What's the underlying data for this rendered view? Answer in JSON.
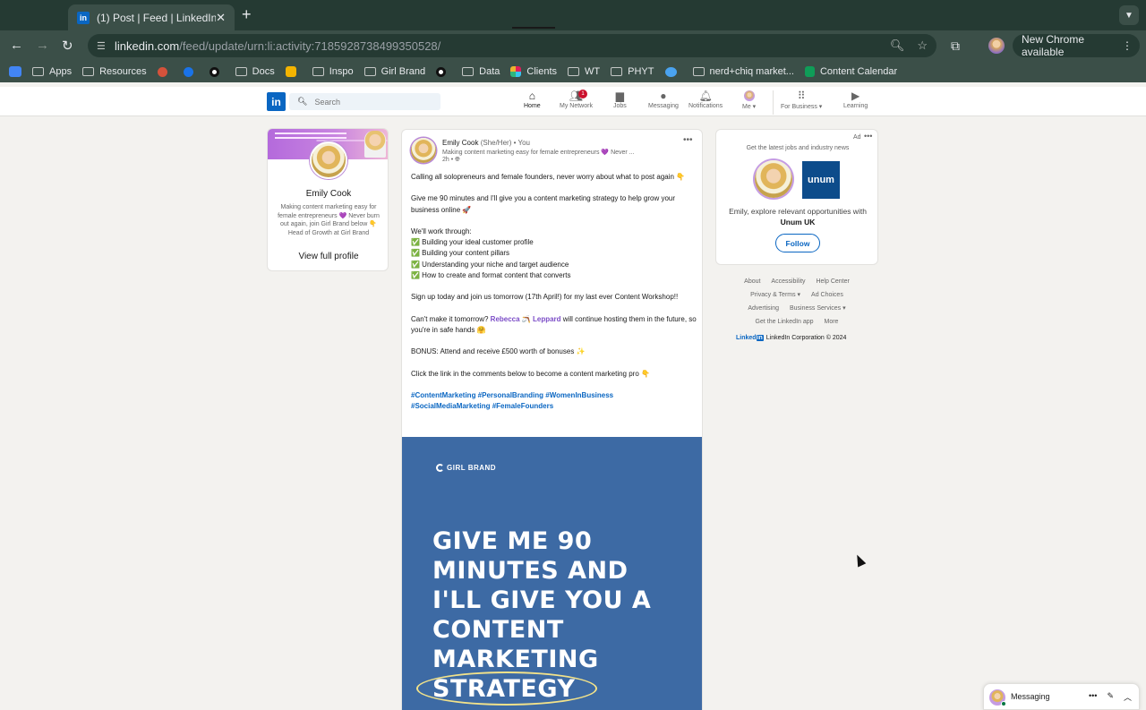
{
  "browser": {
    "tab_title": "(1) Post | Feed | LinkedIn",
    "url_host": "linkedin.com",
    "url_path": "/feed/update/urn:li:activity:7185928738499350528/",
    "new_chrome_label": "New Chrome available",
    "bookmarks": [
      "Apps",
      "Resources",
      "Docs",
      "Inspo",
      "Girl Brand",
      "Data",
      "Clients",
      "WT",
      "PHYT",
      "nerd+chiq market...",
      "Content Calendar"
    ]
  },
  "linkedin": {
    "search_placeholder": "Search",
    "nav": [
      {
        "label": "Home",
        "icon": "home-icon"
      },
      {
        "label": "My Network",
        "icon": "people-icon",
        "badge": "1"
      },
      {
        "label": "Jobs",
        "icon": "briefcase-icon"
      },
      {
        "label": "Messaging",
        "icon": "chat-icon"
      },
      {
        "label": "Notifications",
        "icon": "bell-icon"
      },
      {
        "label": "Me",
        "icon": "avatar-icon"
      },
      {
        "label": "For Business",
        "icon": "grid-icon"
      },
      {
        "label": "Learning",
        "icon": "play-icon"
      }
    ]
  },
  "profile_card": {
    "name": "Emily Cook",
    "headline": "Making content marketing easy for female entrepreneurs 💜 Never burn out again, join Girl Brand below 👇 Head of Growth at Girl Brand",
    "view_profile": "View full profile"
  },
  "post": {
    "author": "Emily Cook",
    "pronouns": "(She/Her)",
    "you_label": "• You",
    "headline": "Making content marketing easy for female entrepreneurs 💜 Never ...",
    "time": "2h •",
    "p1": "Calling all solopreneurs and female founders, never worry about what to post again 👇",
    "p2": "Give me 90 minutes and I'll give you a content marketing strategy to help grow your business online 🚀",
    "p3_intro": "We'll work through:",
    "checklist": [
      "✅ Building your ideal customer profile",
      "✅ Building your content pillars",
      "✅ Understanding your niche and target audience",
      "✅ How to create and format content that converts"
    ],
    "p4": "Sign up today and join us tomorrow (17th April!) for my last ever Content Workshop!!",
    "p5_pre": "Can't make it tomorrow? ",
    "p5_mention": "Rebecca 🪃 Leppard",
    "p5_post": " will continue hosting them in the future, so you're in safe hands 🤗",
    "p6": "BONUS: Attend and receive £500 worth of bonuses ✨",
    "p7": "Click the link in the comments below to become a content marketing pro 👇",
    "hashtags_line1": "#ContentMarketing #PersonalBranding #WomenInBusiness",
    "hashtags_line2": "#SocialMediaMarketing #FemaleFounders",
    "image": {
      "brand": "GIRL BRAND",
      "headline": "GIVE ME 90\nMINUTES AND\nI'LL GIVE YOU A\nCONTENT\nMARKETING\nSTRATEGY"
    }
  },
  "ad": {
    "label": "Ad",
    "tagline": "Get the latest jobs and industry news",
    "logo_text": "unum",
    "text_pre": "Emily, explore relevant opportunities with ",
    "company": "Unum UK",
    "follow": "Follow"
  },
  "footer": {
    "links": [
      "About",
      "Accessibility",
      "Help Center",
      "Privacy & Terms ▾",
      "Ad Choices",
      "Advertising",
      "Business Services ▾",
      "Get the LinkedIn app",
      "More"
    ],
    "copyright": "LinkedIn Corporation © 2024"
  },
  "messaging": {
    "label": "Messaging"
  },
  "colors": {
    "linkedin_blue": "#0a66c2",
    "chrome_dark": "#253a33",
    "chrome_toolbar": "#3b4f48",
    "post_image_bg": "#3d6aa4",
    "mention": "#7b4cc7"
  }
}
